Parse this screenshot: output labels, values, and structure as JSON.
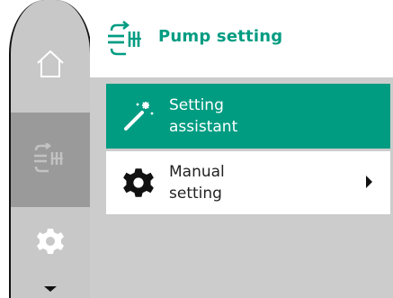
{
  "header": {
    "title": "Pump setting",
    "icon": "pump-setting-icon"
  },
  "sidebar": {
    "items": [
      {
        "name": "home",
        "icon": "home-icon"
      },
      {
        "name": "pump-setting",
        "icon": "pump-setting-icon",
        "active": true
      },
      {
        "name": "settings",
        "icon": "gear-icon"
      },
      {
        "name": "scroll-down",
        "icon": "arrow-down-icon"
      }
    ]
  },
  "menu": {
    "items": [
      {
        "label_line1": "Setting",
        "label_line2": "assistant",
        "icon": "magic-wand-icon",
        "selected": true
      },
      {
        "label_line1": "Manual",
        "label_line2": "setting",
        "icon": "gear-icon",
        "has_submenu": true
      }
    ]
  },
  "colors": {
    "accent": "#009c82",
    "sidebar_bg": "#c8c8c8",
    "sidebar_active": "#9a9a9a",
    "content_bg": "#cccccc"
  }
}
